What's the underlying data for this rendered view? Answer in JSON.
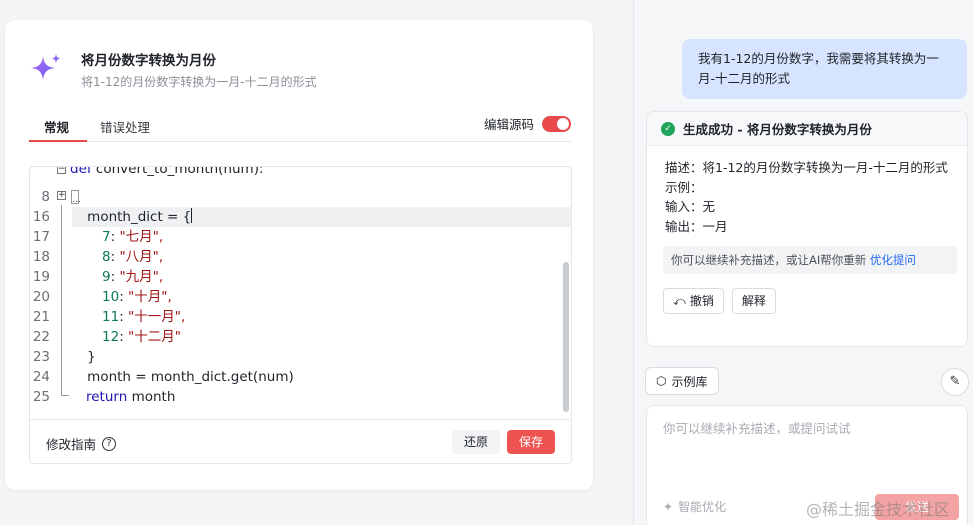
{
  "card": {
    "title": "将月份数字转换为月份",
    "subtitle": "将1-12的月份数字转换为一月-十二月的形式"
  },
  "tabs": [
    {
      "label": "常规",
      "active": true
    },
    {
      "label": "错误处理",
      "active": false
    }
  ],
  "edit_source": {
    "label": "编辑源码",
    "enabled": true
  },
  "code_lines": [
    {
      "num": "8",
      "fold": "collapsed",
      "text": ""
    },
    {
      "num": "16",
      "text": "    month_dict = {"
    },
    {
      "num": "17",
      "key": "7",
      "value": "\"七月\","
    },
    {
      "num": "18",
      "key": "8",
      "value": "\"八月\","
    },
    {
      "num": "19",
      "key": "9",
      "value": "\"九月\","
    },
    {
      "num": "20",
      "key": "10",
      "value": "\"十月\","
    },
    {
      "num": "21",
      "key": "11",
      "value": "\"十一月\","
    },
    {
      "num": "22",
      "key": "12",
      "value": "\"十二月\""
    },
    {
      "num": "23",
      "text": "    }"
    },
    {
      "num": "24",
      "text": "    month = month_dict.get(num)"
    },
    {
      "num": "25",
      "keyword": "return",
      "text": " month"
    }
  ],
  "code_top_partial": {
    "keyword": "def",
    "text": " convert_to_month(num):"
  },
  "editor_footer": {
    "guide_label": "修改指南",
    "restore_label": "还原",
    "save_label": "保存"
  },
  "chat": {
    "user_message": "我有1-12的月份数字，我需要将其转换为一月-十二月的形式",
    "result": {
      "title": "生成成功 - 将月份数字转换为月份",
      "description": "描述：将1-12的月份数字转换为一月-十二月的形式",
      "example_label": "示例：",
      "input_line": "输入：无",
      "output_line": "输出：一月",
      "hint_text": "你可以继续补充描述，或让AI帮你重新",
      "hint_link": "优化提问",
      "undo_label": "撤销",
      "explain_label": "解释"
    },
    "examples_label": "示例库",
    "input_placeholder": "你可以继续补充描述，或提问试试",
    "smart_optimize_label": "智能优化",
    "send_label": "发送"
  },
  "watermark": "@稀土掘金技术社区",
  "colors": {
    "accent": "#ef5350",
    "user_bubble": "#d6e4ff",
    "success": "#20a35a",
    "link": "#2468f2"
  }
}
